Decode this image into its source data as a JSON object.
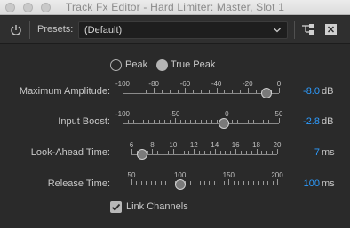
{
  "window": {
    "title": "Track Fx Editor - Hard Limiter: Master, Slot 1"
  },
  "toolbar": {
    "presets_label": "Presets:",
    "preset_value": "(Default)"
  },
  "mode": {
    "options": [
      {
        "label": "Peak",
        "selected": false
      },
      {
        "label": "True Peak",
        "selected": true
      }
    ]
  },
  "params": [
    {
      "label": "Maximum Amplitude:",
      "value": "-8.0",
      "unit": "dB",
      "scale": [
        "-100",
        "-80",
        "-60",
        "-40",
        "-20",
        "0"
      ],
      "min": -100,
      "max": 0,
      "current": -8.0
    },
    {
      "label": "Input Boost:",
      "value": "-2.8",
      "unit": "dB",
      "scale": [
        "-100",
        "-50",
        "0",
        "50"
      ],
      "min": -100,
      "max": 50,
      "current": -2.8
    },
    {
      "label": "Look-Ahead Time:",
      "value": "7",
      "unit": "ms",
      "scale": [
        "6",
        "8",
        "10",
        "12",
        "14",
        "16",
        "18",
        "20"
      ],
      "min": 6,
      "max": 20,
      "current": 7
    },
    {
      "label": "Release Time:",
      "value": "100",
      "unit": "ms",
      "scale": [
        "50",
        "100",
        "150",
        "200"
      ],
      "min": 50,
      "max": 200,
      "current": 100
    }
  ],
  "link_channels": {
    "label": "Link Channels",
    "checked": true
  }
}
